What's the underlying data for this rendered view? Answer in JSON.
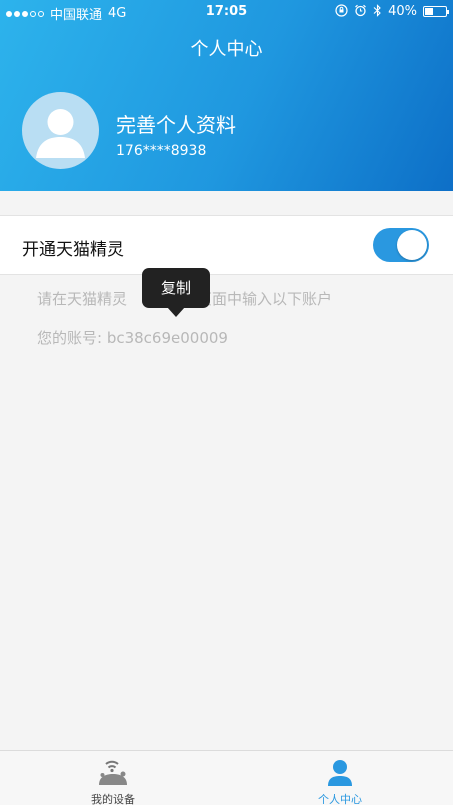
{
  "status_bar": {
    "carrier": "中国联通",
    "network": "4G",
    "time": "17:05",
    "battery_percent": "40%",
    "battery_level": 0.4
  },
  "header": {
    "title": "个人中心",
    "profile_name": "完善个人资料",
    "phone": "176****8938"
  },
  "settings": {
    "toggle_label": "开通天猫精灵",
    "toggle_on": true
  },
  "info": {
    "line1": "请在天猫精灵",
    "line1_rest": "页面中输入以下账户",
    "account_label": "您的账号: bc38c69e00009"
  },
  "tooltip": {
    "label": "复制"
  },
  "tabbar": {
    "tabs": [
      {
        "label": "我的设备",
        "icon": "device-icon",
        "active": false
      },
      {
        "label": "个人中心",
        "icon": "person-icon",
        "active": true
      }
    ]
  },
  "colors": {
    "accent": "#2a98e0",
    "header_start": "#2db3ec",
    "header_end": "#0d6fc7"
  }
}
